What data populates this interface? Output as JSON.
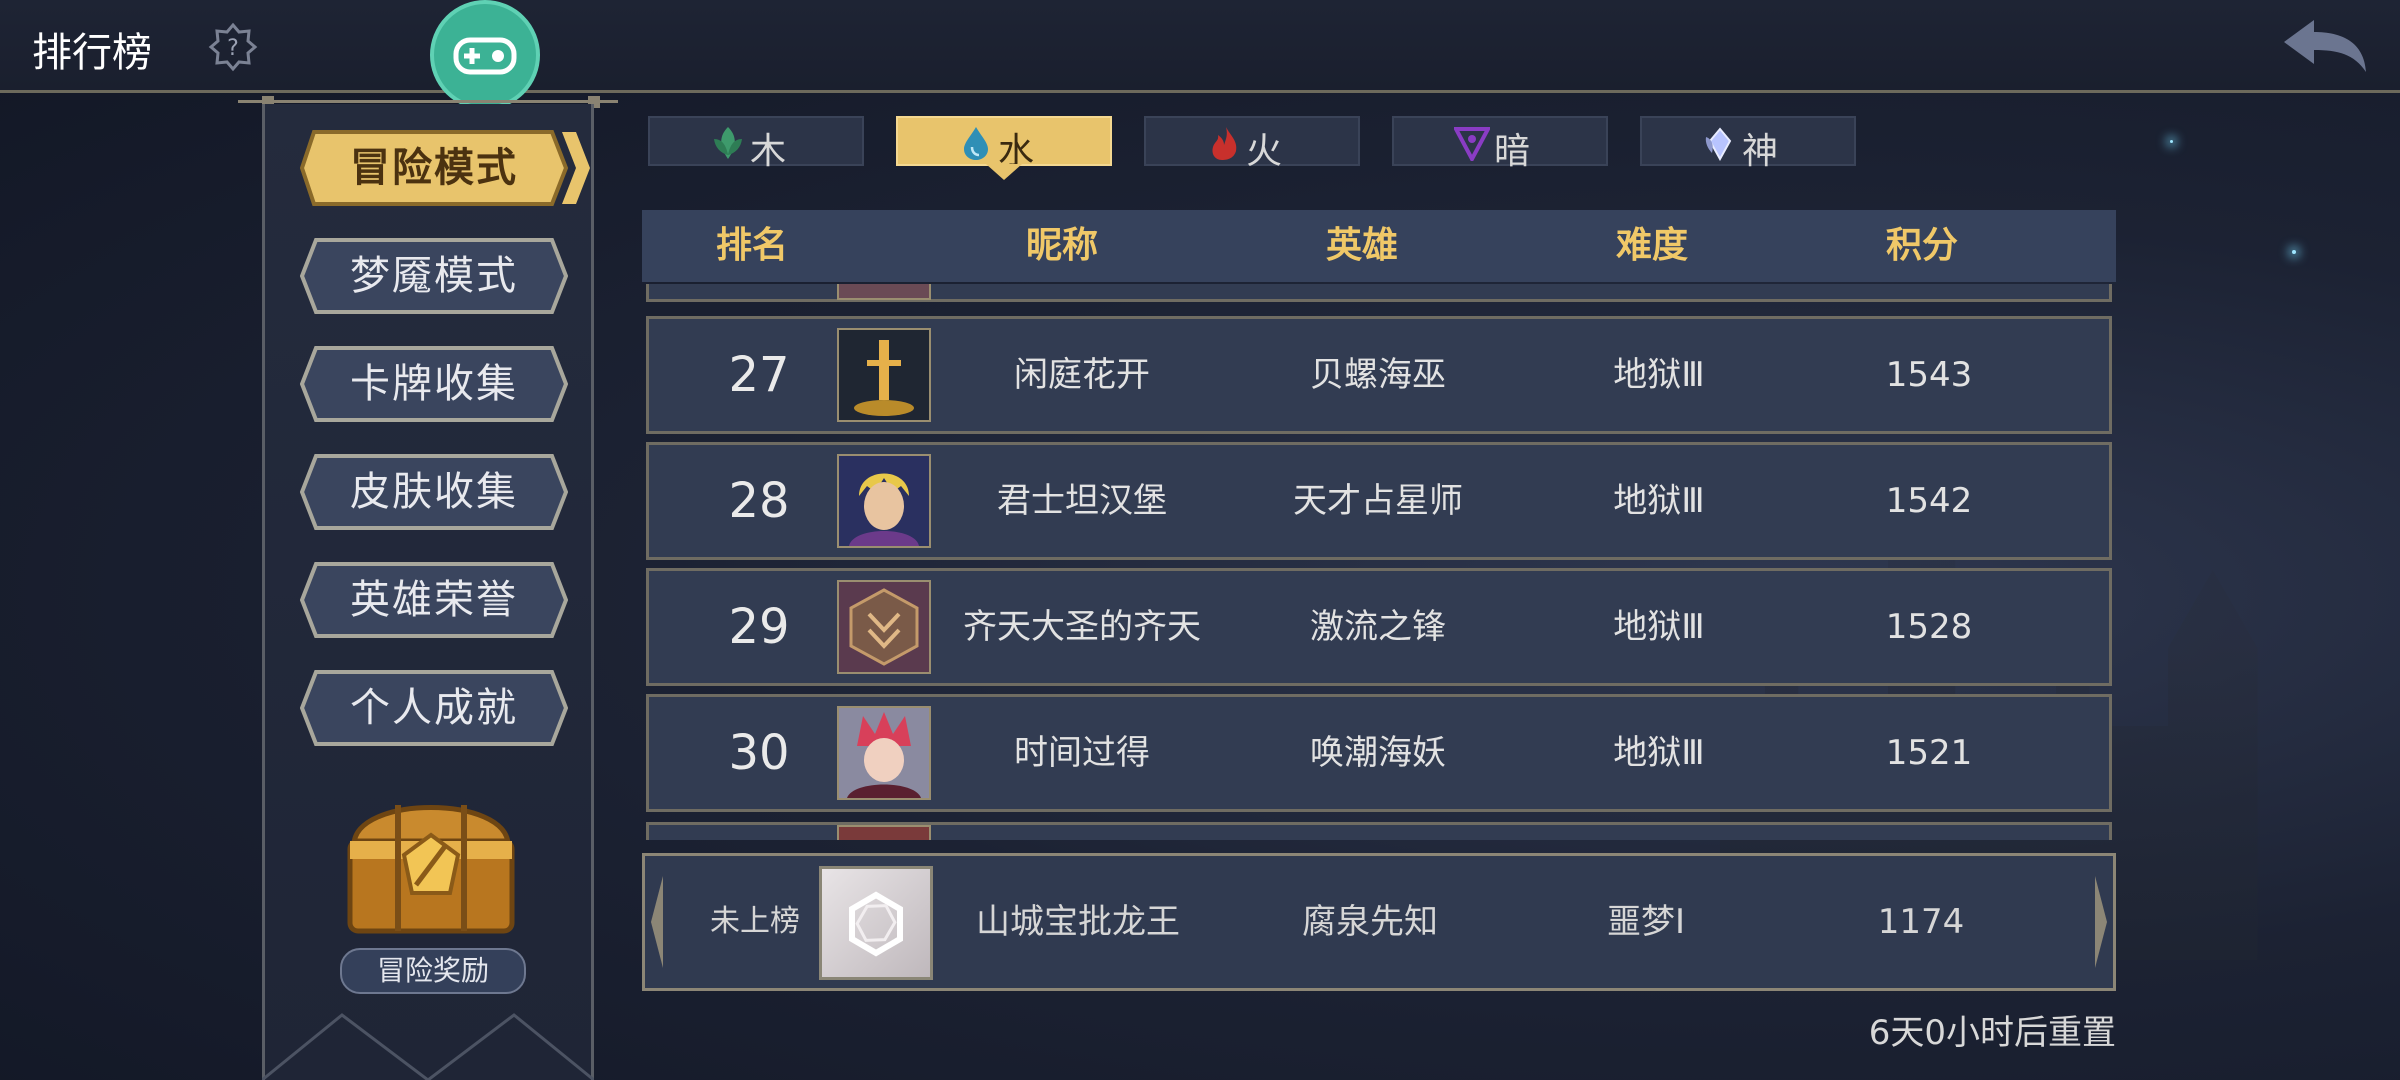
{
  "header": {
    "title": "排行榜",
    "help_icon": "question-icon",
    "back_icon": "back-arrow-icon"
  },
  "menu": [
    {
      "label": "冒险模式",
      "active": true
    },
    {
      "label": "梦魇模式",
      "active": false
    },
    {
      "label": "卡牌收集",
      "active": false
    },
    {
      "label": "皮肤收集",
      "active": false
    },
    {
      "label": "英雄荣誉",
      "active": false
    },
    {
      "label": "个人成就",
      "active": false
    }
  ],
  "reward": {
    "label": "冒险奖励"
  },
  "tabs": [
    {
      "label": "木",
      "icon": "wood-leaf-icon",
      "color": "#3e9a6c",
      "active": false
    },
    {
      "label": "水",
      "icon": "water-drop-icon",
      "color": "#2f8fb6",
      "active": true
    },
    {
      "label": "火",
      "icon": "fire-icon",
      "color": "#c8302c",
      "active": false
    },
    {
      "label": "暗",
      "icon": "dark-sigil-icon",
      "color": "#8a3cc4",
      "active": false
    },
    {
      "label": "神",
      "icon": "divine-wing-icon",
      "color": "#b8c4ff",
      "active": false
    }
  ],
  "table": {
    "headers": [
      "排名",
      "昵称",
      "英雄",
      "难度",
      "积分"
    ],
    "rows": [
      {
        "rank": "27",
        "nickname": "闲庭花开",
        "hero": "贝螺海巫",
        "difficulty": "地狱Ⅲ",
        "score": "1543"
      },
      {
        "rank": "28",
        "nickname": "君士坦汉堡",
        "hero": "天才占星师",
        "difficulty": "地狱Ⅲ",
        "score": "1542"
      },
      {
        "rank": "29",
        "nickname": "齐天大圣的齐天",
        "hero": "激流之锋",
        "difficulty": "地狱Ⅲ",
        "score": "1528"
      },
      {
        "rank": "30",
        "nickname": "时间过得",
        "hero": "唤潮海妖",
        "difficulty": "地狱Ⅲ",
        "score": "1521"
      }
    ]
  },
  "my_entry": {
    "rank": "未上榜",
    "nickname": "山城宝批龙王",
    "hero": "腐泉先知",
    "difficulty": "噩梦Ⅰ",
    "score": "1174"
  },
  "reset_text": "6天0小时后重置",
  "colors": {
    "accent_gold": "#e8c46c",
    "header_text": "#f0c868",
    "panel": "#323c52"
  }
}
